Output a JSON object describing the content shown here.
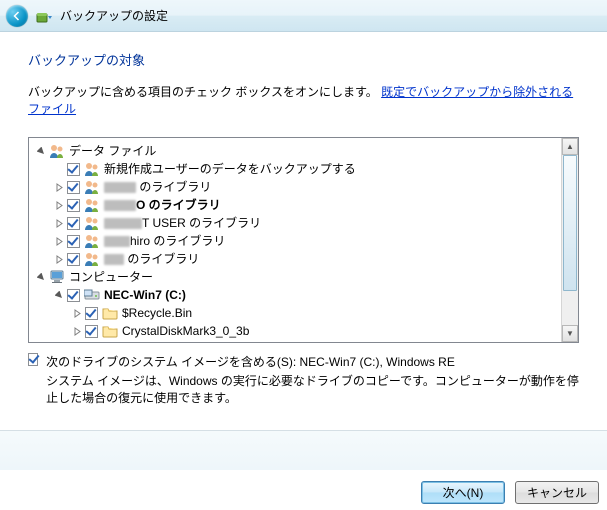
{
  "header": {
    "title": "バックアップの設定"
  },
  "section": {
    "title": "バックアップの対象",
    "desc_prefix": "バックアップに含める項目のチェック ボックスをオンにします。",
    "link": "既定でバックアップから除外されるファイル"
  },
  "tree": {
    "data_files_label": "データ ファイル",
    "new_user_label": "新規作成ユーザーのデータをバックアップする",
    "lib_suffix": " のライブラリ",
    "lib_row2_suffix": "O のライブラリ",
    "lib_row3_suffix": "T USER のライブラリ",
    "lib_row4_suffix": "hiro のライブラリ",
    "computer_label": "コンピューター",
    "drive_label": "NEC-Win7 (C:)",
    "folder1": "$Recycle.Bin",
    "folder2": "CrystalDiskMark3_0_3b"
  },
  "sysimage": {
    "label": "次のドライブのシステム イメージを含める(S): NEC-Win7 (C:), Windows RE",
    "desc": "システム イメージは、Windows の実行に必要なドライブのコピーです。コンピューターが動作を停止した場合の復元に使用できます。"
  },
  "buttons": {
    "next": "次へ(N)",
    "cancel": "キャンセル"
  }
}
